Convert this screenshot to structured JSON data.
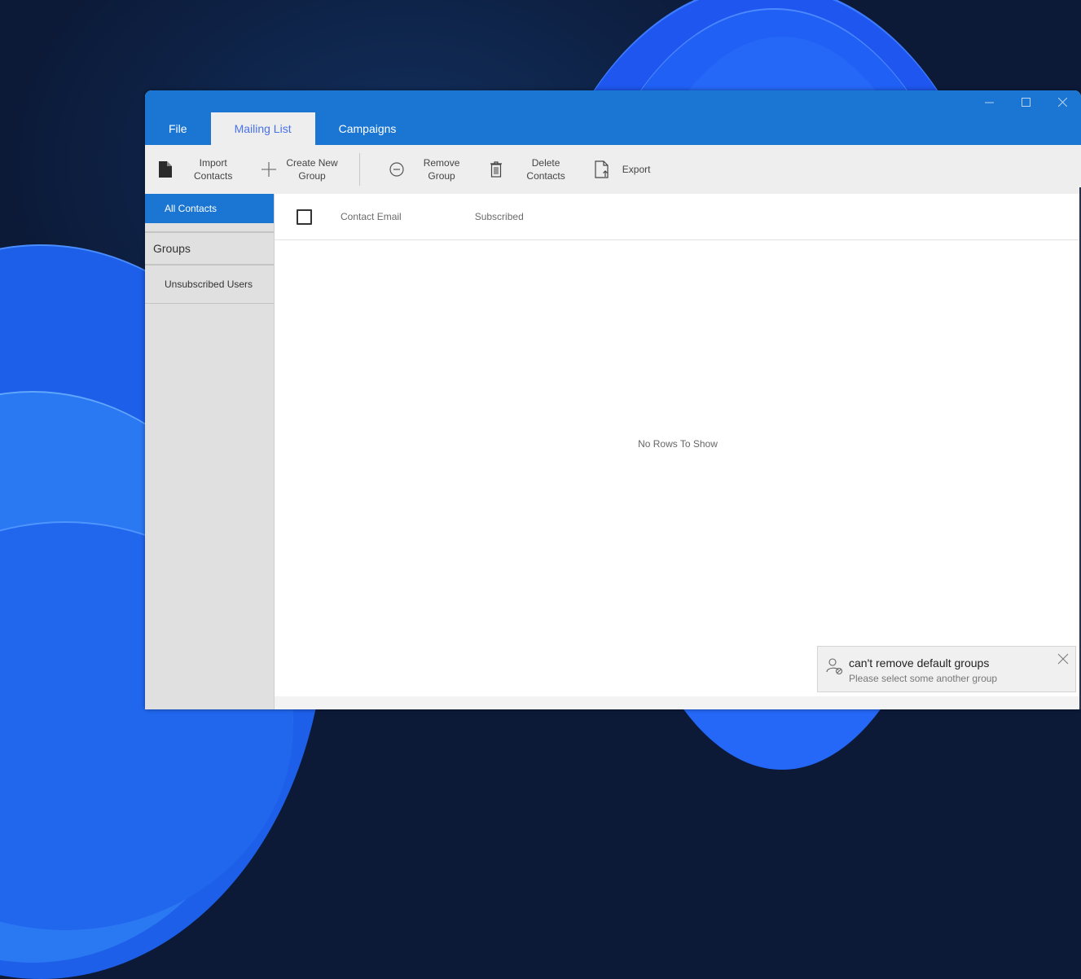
{
  "window": {
    "controls": {
      "minimize_icon": "minimize-icon",
      "maximize_icon": "maximize-icon",
      "close_icon": "close-icon"
    }
  },
  "tabs": [
    {
      "label": "File",
      "active": false
    },
    {
      "label": "Mailing List",
      "active": true
    },
    {
      "label": "Campaigns",
      "active": false
    }
  ],
  "ribbon": {
    "import_contacts": {
      "line1": "Import",
      "line2": "Contacts",
      "icon": "document-icon"
    },
    "create_new_group": {
      "line1": "Create New",
      "line2": "Group",
      "icon": "plus-icon"
    },
    "remove_group": {
      "line1": "Remove",
      "line2": "Group",
      "icon": "minus-circle-icon"
    },
    "delete_contacts": {
      "line1": "Delete",
      "line2": "Contacts",
      "icon": "trash-icon"
    },
    "export": {
      "label": "Export",
      "icon": "export-file-icon"
    }
  },
  "sidebar": {
    "all_contacts": "All Contacts",
    "groups_header": "Groups",
    "unsubscribed_users": "Unsubscribed Users"
  },
  "grid": {
    "columns": [
      "Contact Email",
      "Subscribed"
    ],
    "select_all_checked": false,
    "empty_message": "No Rows To Show",
    "rows": []
  },
  "toast": {
    "icon": "user-blocked-icon",
    "title": "can't remove default groups",
    "message": "Please select some another group"
  },
  "colors": {
    "accent": "#1a76d2",
    "active_tab_text": "#4a72e6",
    "ribbon_bg": "#eeeeee",
    "sidebar_bg": "#e0e0e0"
  }
}
